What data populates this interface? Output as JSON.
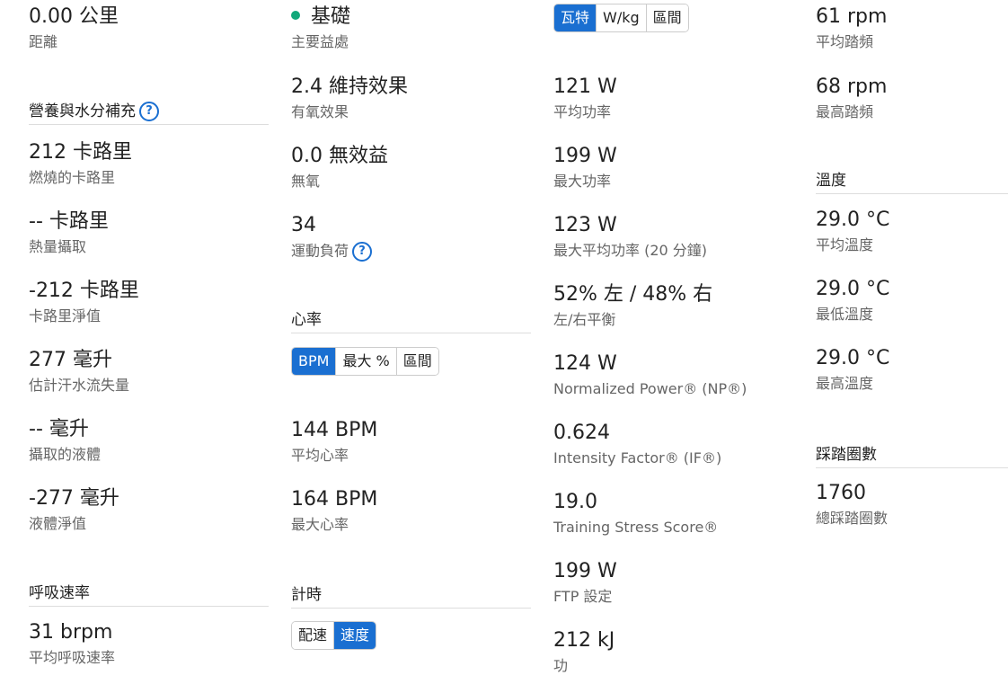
{
  "colors": {
    "accent": "#1a6fd1",
    "benefit_dot": "#12a87a",
    "label": "#666666"
  },
  "col1": {
    "distance": {
      "value": "0.00 公里",
      "label": "距離"
    },
    "nutrition_title": "營養與水分補充",
    "calories_burned": {
      "value": "212 卡路里",
      "label": "燃燒的卡路里"
    },
    "calories_intake": {
      "value": "-- 卡路里",
      "label": "熱量攝取"
    },
    "calories_net": {
      "value": "-212 卡路里",
      "label": "卡路里淨值"
    },
    "sweat_loss": {
      "value": "277 毫升",
      "label": "估計汗水流失量"
    },
    "fluid_intake": {
      "value": "-- 毫升",
      "label": "攝取的液體"
    },
    "fluid_net": {
      "value": "-277 毫升",
      "label": "液體淨值"
    },
    "respiration_title": "呼吸速率",
    "avg_respiration": {
      "value": "31 brpm",
      "label": "平均呼吸速率"
    }
  },
  "col2": {
    "primary_benefit": {
      "value": "基礎",
      "label": "主要益處"
    },
    "aerobic_effect": {
      "value": "2.4 維持效果",
      "label": "有氧效果"
    },
    "anaerobic_effect": {
      "value": "0.0 無效益",
      "label": "無氧"
    },
    "training_load": {
      "value": "34",
      "label": "運動負荷"
    },
    "heart_rate_title": "心率",
    "hr_toggle": [
      "BPM",
      "最大 %",
      "區間"
    ],
    "avg_hr": {
      "value": "144 BPM",
      "label": "平均心率"
    },
    "max_hr": {
      "value": "164 BPM",
      "label": "最大心率"
    },
    "timing_title": "計時",
    "timing_toggle": [
      "配速",
      "速度"
    ]
  },
  "col3": {
    "power_toggle": [
      "瓦特",
      "W/kg",
      "區間"
    ],
    "avg_power": {
      "value": "121 W",
      "label": "平均功率"
    },
    "max_power": {
      "value": "199 W",
      "label": "最大功率"
    },
    "max_avg_power_20": {
      "value": "123 W",
      "label": "最大平均功率 (20 分鐘)"
    },
    "lr_balance": {
      "value": "52% 左 / 48% 右",
      "label": "左/右平衡"
    },
    "np": {
      "value": "124 W",
      "label": "Normalized Power® (NP®)"
    },
    "if": {
      "value": "0.624",
      "label": "Intensity Factor® (IF®)"
    },
    "tss": {
      "value": "19.0",
      "label": "Training Stress Score®"
    },
    "ftp": {
      "value": "199 W",
      "label": "FTP 設定"
    },
    "work": {
      "value": "212 kJ",
      "label": "功"
    }
  },
  "col4": {
    "avg_cadence": {
      "value": "61 rpm",
      "label": "平均踏頻"
    },
    "max_cadence": {
      "value": "68 rpm",
      "label": "最高踏頻"
    },
    "temperature_title": "溫度",
    "avg_temp": {
      "value": "29.0 °C",
      "label": "平均溫度"
    },
    "min_temp": {
      "value": "29.0 °C",
      "label": "最低溫度"
    },
    "max_temp": {
      "value": "29.0 °C",
      "label": "最高溫度"
    },
    "strokes_title": "踩踏圈數",
    "total_strokes": {
      "value": "1760",
      "label": "總踩踏圈數"
    }
  },
  "help_icon_glyph": "?"
}
